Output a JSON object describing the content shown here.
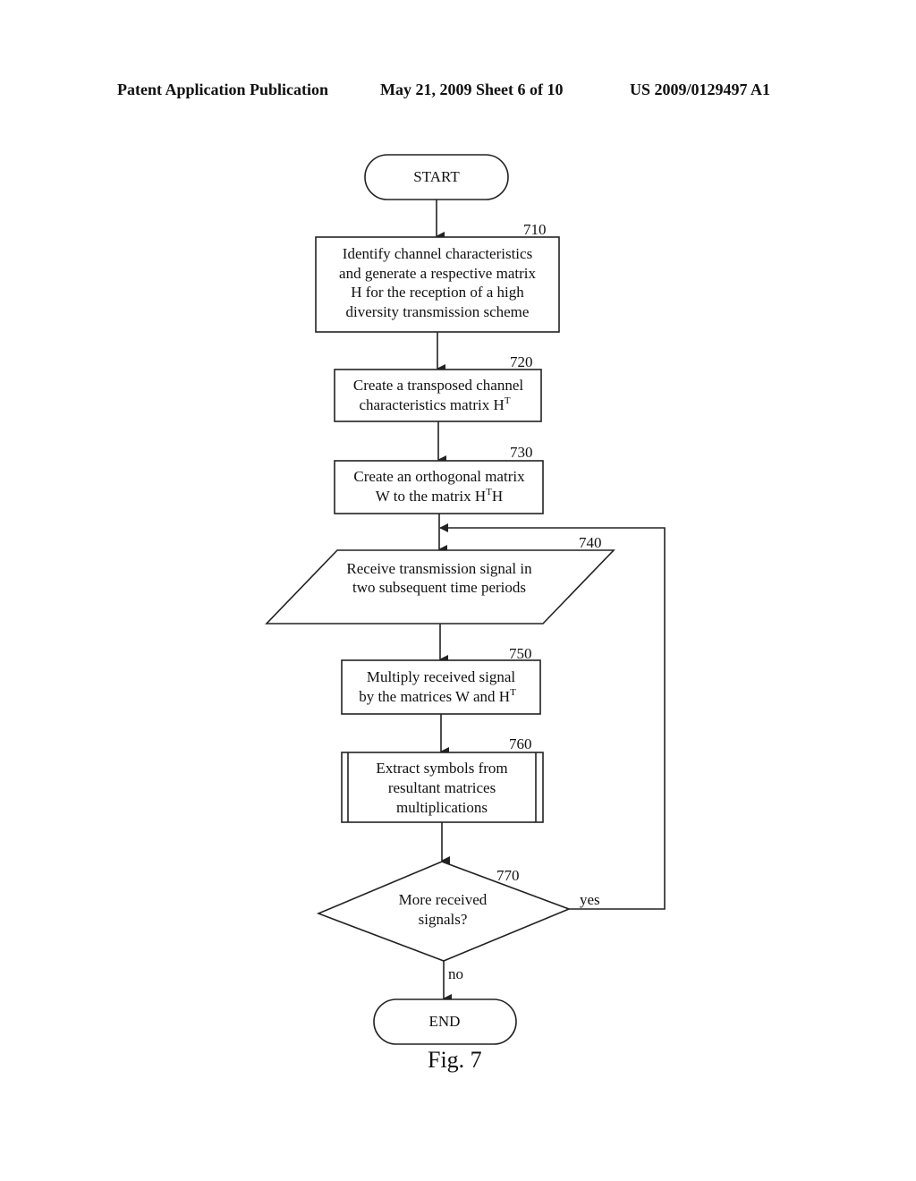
{
  "header": {
    "left": "Patent Application Publication",
    "center": "May 21, 2009  Sheet 6 of 10",
    "right": "US 2009/0129497 A1"
  },
  "flowchart": {
    "start": "START",
    "end": "END",
    "steps": [
      {
        "ref": "710",
        "lines": [
          "Identify channel characteristics",
          "and generate a respective matrix",
          "H for the reception of a high",
          "diversity transmission scheme"
        ]
      },
      {
        "ref": "720",
        "lines": [
          "Create a transposed channel",
          "characteristics matrix H"
        ],
        "sup": "T"
      },
      {
        "ref": "730",
        "lines": [
          "Create an orthogonal matrix",
          "W to the matrix H"
        ],
        "sup": "T",
        "after_sup": "H"
      },
      {
        "ref": "740",
        "lines": [
          "Receive transmission signal in",
          "two subsequent time periods"
        ]
      },
      {
        "ref": "750",
        "lines": [
          "Multiply received signal",
          "by the matrices W and H"
        ],
        "sup": "T"
      },
      {
        "ref": "760",
        "lines": [
          "Extract symbols from",
          "resultant matrices",
          "multiplications"
        ]
      },
      {
        "ref": "770",
        "lines": [
          "More received",
          "signals?"
        ]
      }
    ],
    "yes_label": "yes",
    "no_label": "no"
  },
  "figure_caption": "Fig. 7"
}
